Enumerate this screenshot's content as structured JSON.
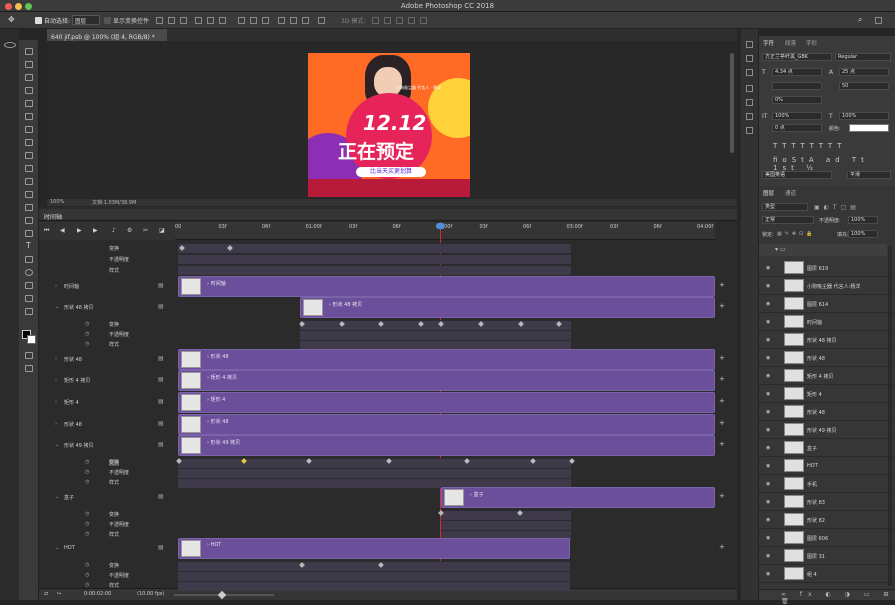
{
  "app": {
    "title": "Adobe Photoshop CC 2018"
  },
  "options_bar": {
    "auto_select_label": "自动选择:",
    "auto_select_value": "图层",
    "transform_label": "显示变换控件",
    "mode_3d": "3D 模式:"
  },
  "document": {
    "tab_title": "640 jif.psb @ 100% (组 4, RGB/8) *",
    "zoom": "100%",
    "doc_info": "文档:1.03M/38.9M"
  },
  "poster": {
    "headline": "12.12",
    "subhead": "正在预定",
    "slogan": "比当天买更划算",
    "brand": "小狗吸尘器 代言人 · 杨洋"
  },
  "timeline": {
    "panel_title": "时间轴",
    "ruler_ticks": [
      "00",
      "03f",
      "06f",
      "01:00f",
      "03f",
      "06f",
      "02:00f",
      "03f",
      "06f",
      "03:00f",
      "03f",
      "06f",
      "04:00f"
    ],
    "current_time": "0:00:02:00",
    "fps": "(10.00 fps)",
    "layers": [
      {
        "name": "时间轴",
        "track_label": "时间轴"
      },
      {
        "name": "形状 48 拷贝",
        "track_label": "形状 48 拷贝"
      },
      {
        "name": "形状 48",
        "track_label": "形状 48"
      },
      {
        "name": "矩形 4 拷贝",
        "track_label": "矩形 4 拷贝"
      },
      {
        "name": "矩形 4",
        "track_label": "矩形 4"
      },
      {
        "name": "形状 48",
        "track_label": "形状 48"
      },
      {
        "name": "形状 49 拷贝",
        "track_label": "形状 49 拷贝"
      },
      {
        "name": "盒子",
        "track_label": "盒子"
      },
      {
        "name": "HOT",
        "track_label": "HOT"
      }
    ],
    "sub_labels": {
      "transform": "变换",
      "opacity": "不透明度",
      "style": "样式"
    }
  },
  "character_panel": {
    "tabs": [
      "字符",
      "段落",
      "字形"
    ],
    "font_family": "方正兰亭纤黑_GBK",
    "font_style": "Regular",
    "font_size": "4.34 点",
    "leading": "25 点",
    "tracking": "50",
    "vertical_scale": "100%",
    "horizontal_scale": "100%",
    "baseline": "0 点",
    "color_label": "颜色:",
    "language": "美国英语",
    "antialias": "平滑",
    "kerning": "0%"
  },
  "layers_panel": {
    "tabs": [
      "图层",
      "通道"
    ],
    "kind_filter": "类型",
    "blend_mode": "正常",
    "opacity_label": "不透明度:",
    "opacity": "100%",
    "lock_label": "锁定:",
    "fill_label": "填充:",
    "fill": "100%",
    "items": [
      "图层 619",
      "小狗吸尘器 代言人:杨洋",
      "图层 614",
      "时间轴",
      "形状 48 拷贝",
      "形状 48",
      "矩形 4 拷贝",
      "矩形 4",
      "形状 48",
      "形状 49 拷贝",
      "盒子",
      "HOT",
      "手机",
      "形状 83",
      "形状 82",
      "图层 606",
      "图层 31",
      "组 4"
    ]
  },
  "colors": {
    "accent_track": "#6b4f9a",
    "playhead": "#d62b2b",
    "panel": "#3a3a3a"
  }
}
